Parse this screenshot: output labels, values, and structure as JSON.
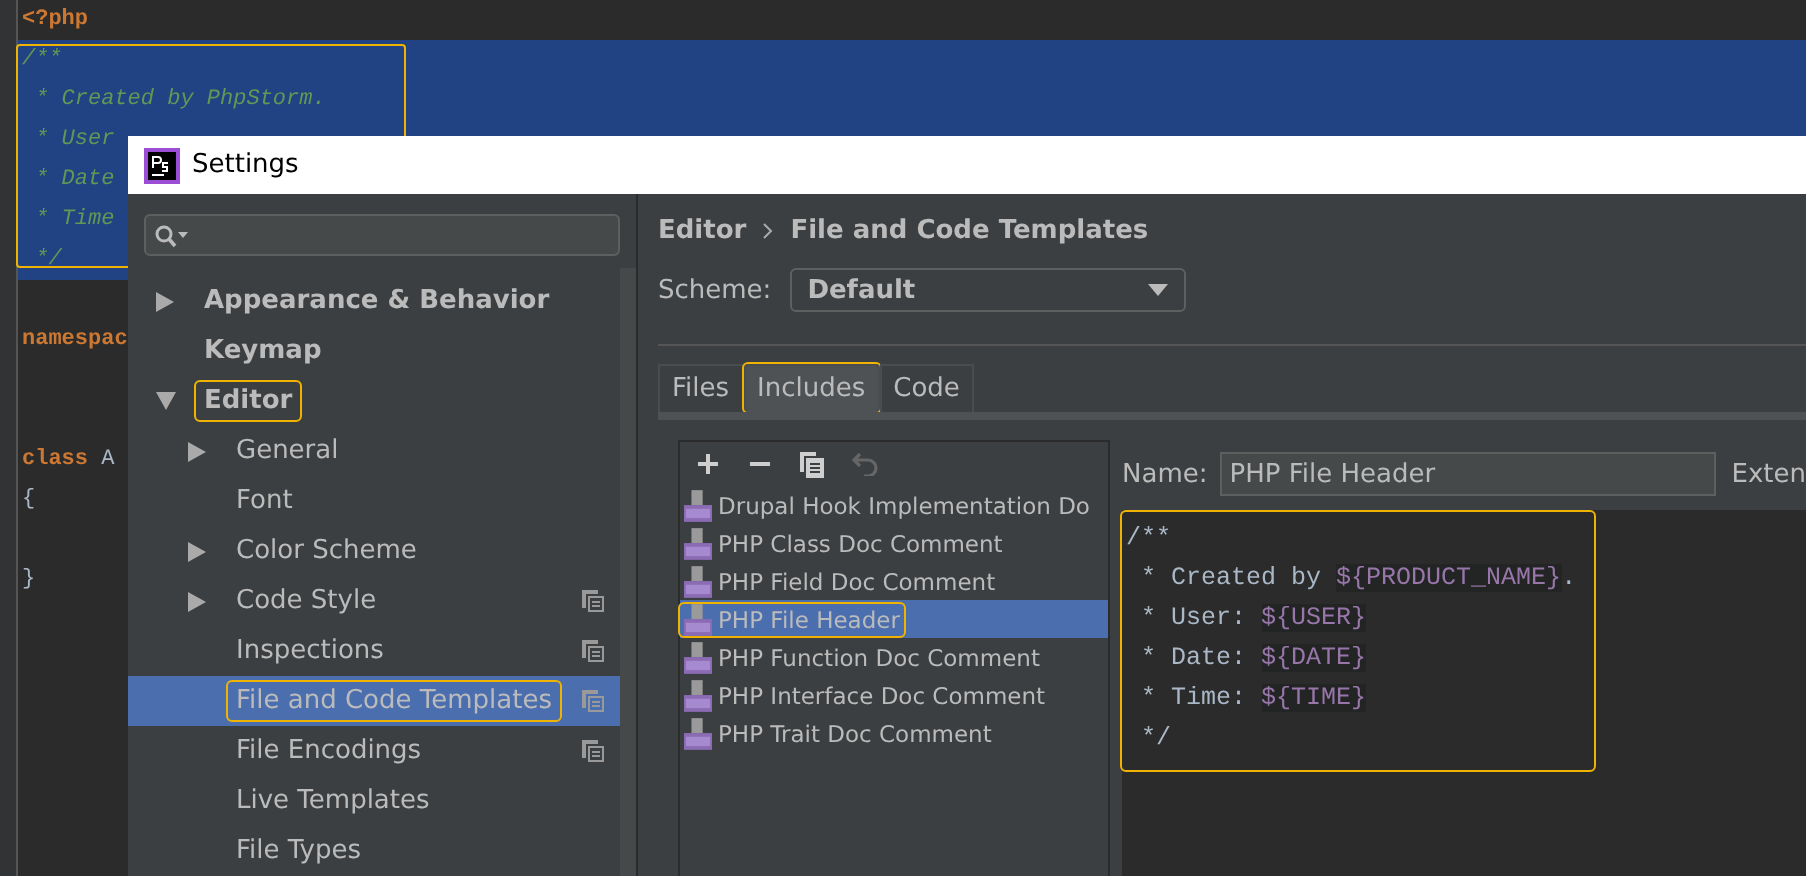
{
  "editor": {
    "highlighted": true,
    "lines": [
      {
        "kind": "code",
        "selected": false,
        "segments": [
          {
            "text": "<?php",
            "kind": "keyword"
          }
        ]
      },
      {
        "kind": "code",
        "selected": true,
        "segments": [
          {
            "text": "/**",
            "kind": "comment"
          }
        ]
      },
      {
        "kind": "code",
        "selected": true,
        "segments": [
          {
            "text": " * Created by PhpStorm.",
            "kind": "comment"
          }
        ]
      },
      {
        "kind": "code",
        "selected": true,
        "segments": [
          {
            "text": " * User",
            "kind": "comment"
          }
        ]
      },
      {
        "kind": "code",
        "selected": true,
        "segments": [
          {
            "text": " * Date",
            "kind": "comment"
          }
        ]
      },
      {
        "kind": "code",
        "selected": true,
        "segments": [
          {
            "text": " * Time",
            "kind": "comment"
          }
        ]
      },
      {
        "kind": "code",
        "selected": true,
        "segments": [
          {
            "text": " */",
            "kind": "comment"
          }
        ]
      },
      {
        "kind": "blank"
      },
      {
        "kind": "code",
        "selected": false,
        "segments": [
          {
            "text": "namespac",
            "kind": "keyword"
          }
        ]
      },
      {
        "kind": "blank"
      },
      {
        "kind": "blank"
      },
      {
        "kind": "code",
        "selected": false,
        "segments": [
          {
            "text": "class",
            "kind": "keyword"
          },
          {
            "text": " A",
            "kind": "plain"
          }
        ]
      },
      {
        "kind": "code",
        "selected": false,
        "segments": [
          {
            "text": "{",
            "kind": "plain"
          }
        ]
      },
      {
        "kind": "blank"
      },
      {
        "kind": "code",
        "selected": false,
        "segments": [
          {
            "text": "}",
            "kind": "plain"
          }
        ]
      }
    ]
  },
  "window": {
    "title": "Settings"
  },
  "sidebar": {
    "items": [
      {
        "label": "Appearance & Behavior",
        "bold": true,
        "expanded": false,
        "selected": false
      },
      {
        "label": "Keymap",
        "bold": true,
        "selected": false
      },
      {
        "label": "Editor",
        "bold": true,
        "expanded": true,
        "selected": false,
        "highlighted": true,
        "children": [
          {
            "label": "General",
            "expanded": false,
            "selected": false
          },
          {
            "label": "Font",
            "selected": false
          },
          {
            "label": "Color Scheme",
            "expanded": false,
            "selected": false
          },
          {
            "label": "Code Style",
            "expanded": false,
            "selected": false,
            "copy_icon": true
          },
          {
            "label": "Inspections",
            "selected": false,
            "copy_icon": true
          },
          {
            "label": "File and Code Templates",
            "selected": true,
            "highlighted": true,
            "copy_icon": true
          },
          {
            "label": "File Encodings",
            "selected": false,
            "copy_icon": true
          },
          {
            "label": "Live Templates",
            "selected": false
          },
          {
            "label": "File Types",
            "selected": false
          }
        ]
      }
    ]
  },
  "breadcrumb": [
    "Editor",
    "File and Code Templates"
  ],
  "scheme": {
    "label": "Scheme:",
    "value": "Default"
  },
  "tabs": [
    {
      "label": "Files",
      "selected": false,
      "highlighted": false
    },
    {
      "label": "Includes",
      "selected": true,
      "highlighted": true
    },
    {
      "label": "Code",
      "selected": false,
      "highlighted": false
    }
  ],
  "toolbar": [
    {
      "kind": "add",
      "disabled": false
    },
    {
      "kind": "remove",
      "disabled": false
    },
    {
      "kind": "copy",
      "disabled": false
    },
    {
      "kind": "undo",
      "disabled": true
    }
  ],
  "templates": [
    {
      "label": "Drupal Hook Implementation Do",
      "selected": false,
      "highlighted": false
    },
    {
      "label": "PHP Class Doc Comment",
      "selected": false,
      "highlighted": false
    },
    {
      "label": "PHP Field Doc Comment",
      "selected": false,
      "highlighted": false
    },
    {
      "label": "PHP File Header",
      "selected": true,
      "highlighted": true
    },
    {
      "label": "PHP Function Doc Comment",
      "selected": false,
      "highlighted": false
    },
    {
      "label": "PHP Interface Doc Comment",
      "selected": false,
      "highlighted": false
    },
    {
      "label": "PHP Trait Doc Comment",
      "selected": false,
      "highlighted": false
    }
  ],
  "name_field": {
    "label": "Name:",
    "value": "PHP File Header"
  },
  "extension_label": "Exten",
  "template_code": {
    "highlighted": true,
    "lines": [
      [
        {
          "text": "/**",
          "kind": "plain"
        }
      ],
      [
        {
          "text": " * Created by ",
          "kind": "plain"
        },
        {
          "text": "${PRODUCT_NAME}",
          "kind": "variable"
        },
        {
          "text": ".",
          "kind": "plain"
        }
      ],
      [
        {
          "text": " * User: ",
          "kind": "plain"
        },
        {
          "text": "${USER}",
          "kind": "variable"
        }
      ],
      [
        {
          "text": " * Date: ",
          "kind": "plain"
        },
        {
          "text": "${DATE}",
          "kind": "variable"
        }
      ],
      [
        {
          "text": " * Time: ",
          "kind": "plain"
        },
        {
          "text": "${TIME}",
          "kind": "variable"
        }
      ],
      [
        {
          "text": " */",
          "kind": "plain"
        }
      ]
    ]
  }
}
